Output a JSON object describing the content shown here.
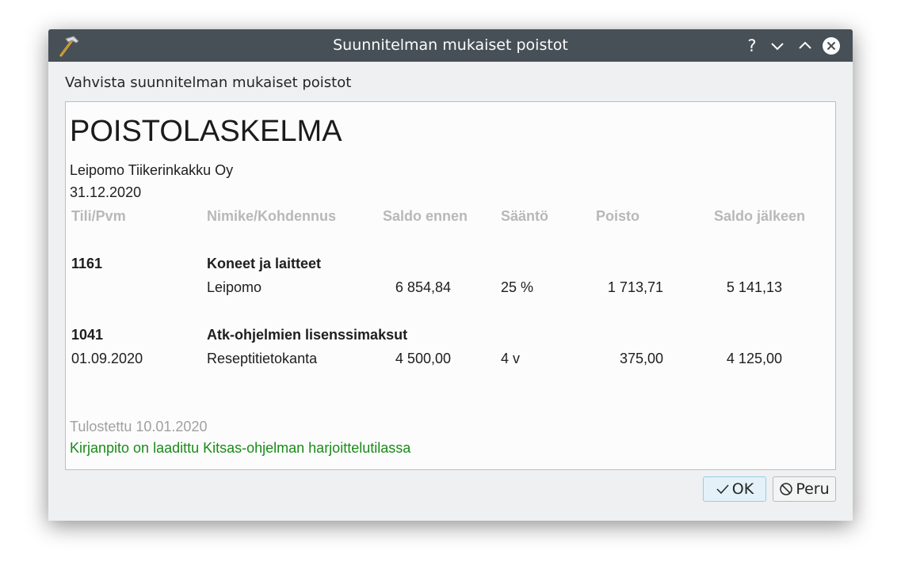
{
  "window": {
    "title": "Suunnitelman mukaiset poistot",
    "help_glyph": "?",
    "prompt": "Vahvista suunnitelman mukaiset poistot"
  },
  "report": {
    "heading": "POISTOLASKELMA",
    "company": "Leipomo Tiikerinkakku Oy",
    "date": "31.12.2020",
    "columns": [
      "Tili/Pvm",
      "Nimike/Kohdennus",
      "Saldo ennen",
      "Sääntö",
      "Poisto",
      "Saldo jälkeen"
    ],
    "groups": [
      {
        "account": "1161",
        "name": "Koneet ja laitteet",
        "row": {
          "date": "",
          "target": "Leipomo",
          "balance_before": "6 854,84",
          "rule": "25 %",
          "depreciation": "1 713,71",
          "balance_after": "5 141,13"
        }
      },
      {
        "account": "1041",
        "name": "Atk-ohjelmien lisenssimaksut",
        "row": {
          "date": "01.09.2020",
          "target": "Reseptitietokanta",
          "balance_before": "4 500,00",
          "rule": "4 v",
          "depreciation": "375,00",
          "balance_after": "4 125,00"
        }
      }
    ],
    "printed": "Tulostettu 10.01.2020",
    "practice_note": "Kirjanpito on laadittu Kitsas-ohjelman harjoittelutilassa"
  },
  "buttons": {
    "ok_label": "OK",
    "cancel_label": "Peru"
  },
  "colors": {
    "titlebar": "#475057",
    "dialog_bg": "#eff0f1",
    "header_text": "#b8b8b8",
    "practice_note": "#1a8a1a",
    "ok_highlight": "#93cee9"
  },
  "icons": {
    "app": "hammer-icon",
    "minimize": "chevron-down-icon",
    "maximize": "chevron-up-icon",
    "close": "close-icon",
    "ok": "checkmark-icon",
    "cancel": "cancel-icon"
  }
}
